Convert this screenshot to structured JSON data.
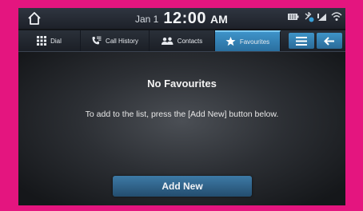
{
  "status_bar": {
    "date": "Jan 1",
    "time": "12:00",
    "ampm": "AM",
    "icons": [
      "home-icon",
      "battery-icon",
      "bluetooth-phone-icon",
      "signal-icon",
      "wifi-icon"
    ]
  },
  "tabs": [
    {
      "label": "Dial",
      "icon": "keypad-icon",
      "active": false
    },
    {
      "label": "Call History",
      "icon": "call-history-icon",
      "active": false
    },
    {
      "label": "Contacts",
      "icon": "contacts-icon",
      "active": false
    },
    {
      "label": "Favourites",
      "icon": "star-icon",
      "active": true
    }
  ],
  "toolbar": {
    "menu_icon": "menu-icon",
    "back_icon": "back-arrow-icon"
  },
  "main": {
    "empty_title": "No Favourites",
    "empty_message": "To add to the list, press the [Add New] button below.",
    "add_new_label": "Add New"
  },
  "colors": {
    "frame": "#e4157f",
    "accent": "#3a8fc4",
    "background": "#121418"
  }
}
